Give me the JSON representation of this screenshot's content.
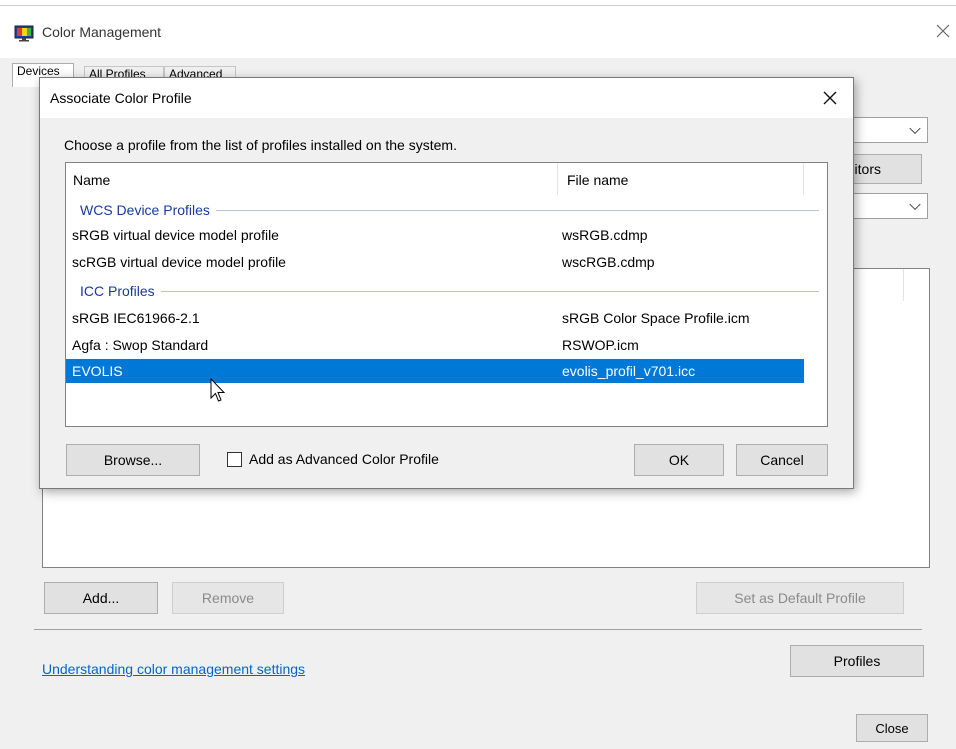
{
  "colors": {
    "accent": "#0078d7",
    "link": "#0066cc",
    "group_header": "#1a3a9c",
    "selection_text": "#ffffff"
  },
  "main_window": {
    "title": "Color Management",
    "tabs": [
      "Devices",
      "All Profiles",
      "Advanced"
    ],
    "partial_button_label": "itors",
    "buttons": {
      "add": "Add...",
      "remove": "Remove",
      "set_default": "Set as Default Profile",
      "profiles": "Profiles",
      "close": "Close"
    },
    "help_link": "Understanding color management settings"
  },
  "dialog": {
    "title": "Associate Color Profile",
    "instruction": "Choose a profile from the list of profiles installed on the system.",
    "columns": {
      "name": "Name",
      "file": "File name"
    },
    "groups": [
      {
        "title": "WCS Device Profiles",
        "items": [
          {
            "name": "sRGB virtual device model profile",
            "file": "wsRGB.cdmp"
          },
          {
            "name": "scRGB virtual device model profile",
            "file": "wscRGB.cdmp"
          }
        ]
      },
      {
        "title": "ICC Profiles",
        "items": [
          {
            "name": "sRGB IEC61966-2.1",
            "file": "sRGB Color Space Profile.icm"
          },
          {
            "name": "Agfa : Swop Standard",
            "file": "RSWOP.icm"
          },
          {
            "name": "EVOLIS",
            "file": "evolis_profil_v701.icc",
            "selected": true
          }
        ]
      }
    ],
    "buttons": {
      "browse": "Browse...",
      "ok": "OK",
      "cancel": "Cancel"
    },
    "checkbox": {
      "label": "Add as Advanced Color Profile",
      "checked": false
    }
  }
}
